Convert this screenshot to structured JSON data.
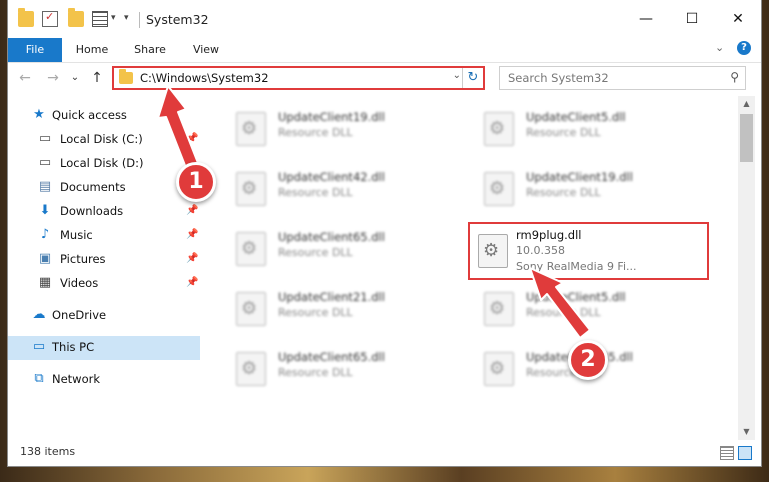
{
  "window": {
    "title": "System32",
    "controls": {
      "minimize": "—",
      "maximize": "☐",
      "close": "✕"
    }
  },
  "ribbon": {
    "tabs": [
      "File",
      "Home",
      "Share",
      "View"
    ],
    "expand_glyph": "⌄",
    "help_glyph": "?"
  },
  "nav": {
    "back": "←",
    "forward": "→",
    "recent": "⌄",
    "up": "↑",
    "address": "C:\\Windows\\System32",
    "address_dropdown": "⌄",
    "refresh": "↻",
    "search_placeholder": "Search System32",
    "search_glyph": "⚲"
  },
  "sidebar": {
    "items": [
      {
        "label": "Quick access",
        "icon": "star-icon",
        "glyph": "★",
        "color": "#1979ca"
      },
      {
        "label": "Local Disk (C:)",
        "icon": "drive-icon",
        "glyph": "▭",
        "color": "#555555",
        "pinned": true
      },
      {
        "label": "Local Disk (D:)",
        "icon": "drive-icon",
        "glyph": "▭",
        "color": "#555555",
        "pinned": true
      },
      {
        "label": "Documents",
        "icon": "documents-icon",
        "glyph": "▤",
        "color": "#5a7fa8",
        "pinned": true
      },
      {
        "label": "Downloads",
        "icon": "downloads-icon",
        "glyph": "⬇",
        "color": "#1979ca",
        "pinned": true
      },
      {
        "label": "Music",
        "icon": "music-icon",
        "glyph": "♪",
        "color": "#1979ca",
        "pinned": true
      },
      {
        "label": "Pictures",
        "icon": "pictures-icon",
        "glyph": "▣",
        "color": "#4a7fb0",
        "pinned": true
      },
      {
        "label": "Videos",
        "icon": "videos-icon",
        "glyph": "▦",
        "color": "#444444",
        "pinned": true
      },
      {
        "label": "OneDrive",
        "icon": "onedrive-icon",
        "glyph": "☁",
        "color": "#1979ca"
      },
      {
        "label": "This PC",
        "icon": "computer-icon",
        "glyph": "▭",
        "color": "#1979ca",
        "selected": true
      },
      {
        "label": "Network",
        "icon": "network-icon",
        "glyph": "⧉",
        "color": "#1979ca"
      }
    ],
    "pin_glyph": "📌"
  },
  "files": {
    "items": [
      {
        "name": "UpdateClient19.dll",
        "type": "Resource DLL"
      },
      {
        "name": "UpdateClient5.dll",
        "type": "Resource DLL"
      },
      {
        "name": "UpdateClient42.dll",
        "type": "Resource DLL"
      },
      {
        "name": "UpdateClient19.dll",
        "type": "Resource DLL"
      },
      {
        "name": "UpdateClient65.dll",
        "type": "Resource DLL"
      },
      {
        "name": "UpdateClient21.dll",
        "type": "Resource DLL"
      },
      {
        "name": "UpdateClient5.dll",
        "type": "Resource DLL"
      },
      {
        "name": "UpdateClient65.dll",
        "type": "Resource DLL"
      },
      {
        "name": "UpdateClient65.dll",
        "type": "Resource DLL"
      }
    ],
    "highlighted": {
      "name": "rm9plug.dll",
      "version": "10.0.358",
      "description": "Sony RealMedia 9 Fi..."
    }
  },
  "scrollbar": {
    "up": "▲",
    "down": "▼"
  },
  "status": {
    "item_count": "138 items"
  },
  "annotations": {
    "step1": "1",
    "step2": "2",
    "color": "#e03b3b"
  }
}
